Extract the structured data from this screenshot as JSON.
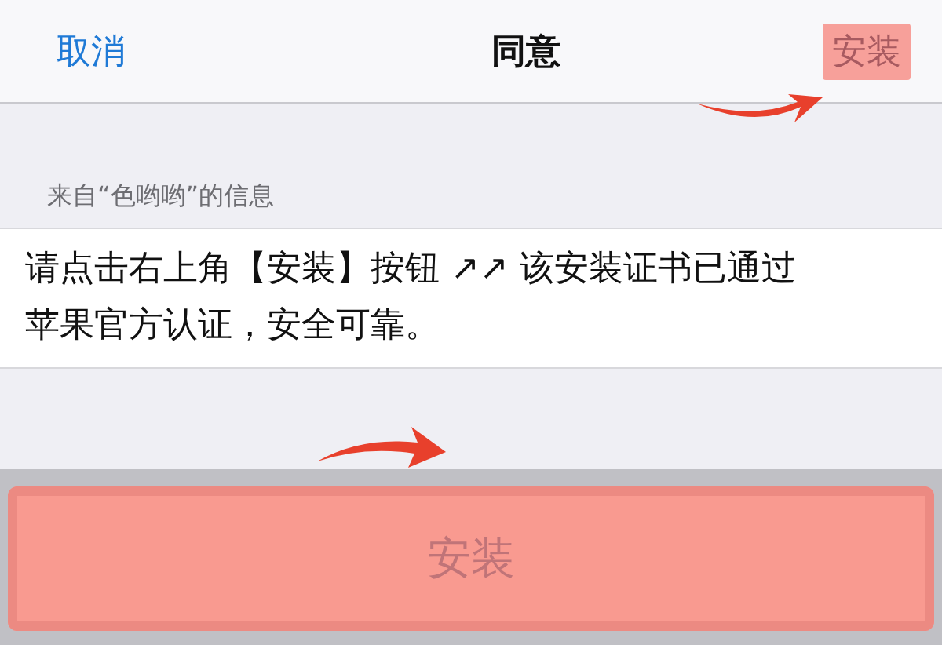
{
  "nav_bar": {
    "cancel": "取消",
    "title": "同意",
    "install": "安装"
  },
  "section_header": "来自“色哟哟”的信息",
  "message": "请点击右上角【安装】按钮 ↗↗ 该安装证书已通过苹果官方认证，安全可靠。",
  "action_sheet": {
    "button": "安装"
  }
}
